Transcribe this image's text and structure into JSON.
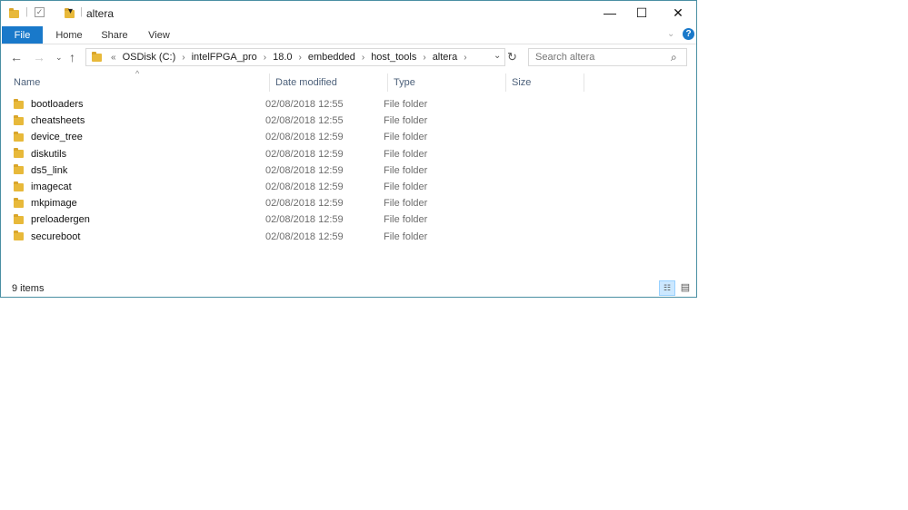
{
  "window": {
    "title": "altera",
    "minimize": "—",
    "maximize": "☐",
    "close": "✕"
  },
  "ribbon": {
    "tabs": [
      "File",
      "Home",
      "Share",
      "View"
    ],
    "help": "?"
  },
  "address": {
    "overflow": "«",
    "crumbs": [
      "OSDisk (C:)",
      "intelFPGA_pro",
      "18.0",
      "embedded",
      "host_tools",
      "altera"
    ]
  },
  "search": {
    "placeholder": "Search altera"
  },
  "columns": [
    "Name",
    "Date modified",
    "Type",
    "Size"
  ],
  "files": [
    {
      "name": "bootloaders",
      "date": "02/08/2018 12:55",
      "type": "File folder"
    },
    {
      "name": "cheatsheets",
      "date": "02/08/2018 12:55",
      "type": "File folder"
    },
    {
      "name": "device_tree",
      "date": "02/08/2018 12:59",
      "type": "File folder"
    },
    {
      "name": "diskutils",
      "date": "02/08/2018 12:59",
      "type": "File folder"
    },
    {
      "name": "ds5_link",
      "date": "02/08/2018 12:59",
      "type": "File folder"
    },
    {
      "name": "imagecat",
      "date": "02/08/2018 12:59",
      "type": "File folder"
    },
    {
      "name": "mkpimage",
      "date": "02/08/2018 12:59",
      "type": "File folder"
    },
    {
      "name": "preloadergen",
      "date": "02/08/2018 12:59",
      "type": "File folder"
    },
    {
      "name": "secureboot",
      "date": "02/08/2018 12:59",
      "type": "File folder"
    }
  ],
  "status": {
    "count": "9 items"
  }
}
